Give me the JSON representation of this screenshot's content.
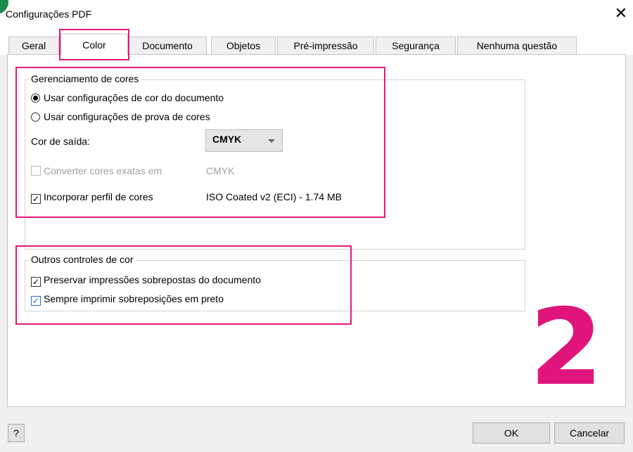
{
  "window": {
    "title": "Configurações PDF",
    "close_icon": "close-icon"
  },
  "tabs": [
    {
      "label": "Geral"
    },
    {
      "label": "Color"
    },
    {
      "label": "Documento"
    },
    {
      "label": "Objetos"
    },
    {
      "label": "Pré-impressão"
    },
    {
      "label": "Segurança"
    },
    {
      "label": "Nenhuma questão"
    }
  ],
  "active_tab": "Color",
  "color_management": {
    "legend": "Gerenciamento de cores",
    "radio_document": "Usar configurações de cor do documento",
    "radio_proof": "Usar configurações de prova de cores",
    "output_color_label": "Cor de saída:",
    "output_color_value": "CMYK",
    "convert_label": "Converter cores exatas em",
    "convert_value": "CMYK",
    "embed_label": "Incorporar perfil de cores",
    "embed_value": "ISO Coated v2 (ECI) - 1.74 MB"
  },
  "other_controls": {
    "legend": "Outros controles de cor",
    "preserve_label": "Preservar impressões sobrepostas do documento",
    "black_label": "Sempre imprimir sobreposições em preto"
  },
  "annotation_number": "2",
  "footer": {
    "help_label": "?",
    "ok_label": "OK",
    "cancel_label": "Cancelar"
  },
  "colors": {
    "highlight": "#e2197a",
    "accent_check": "#2a6fd6"
  }
}
